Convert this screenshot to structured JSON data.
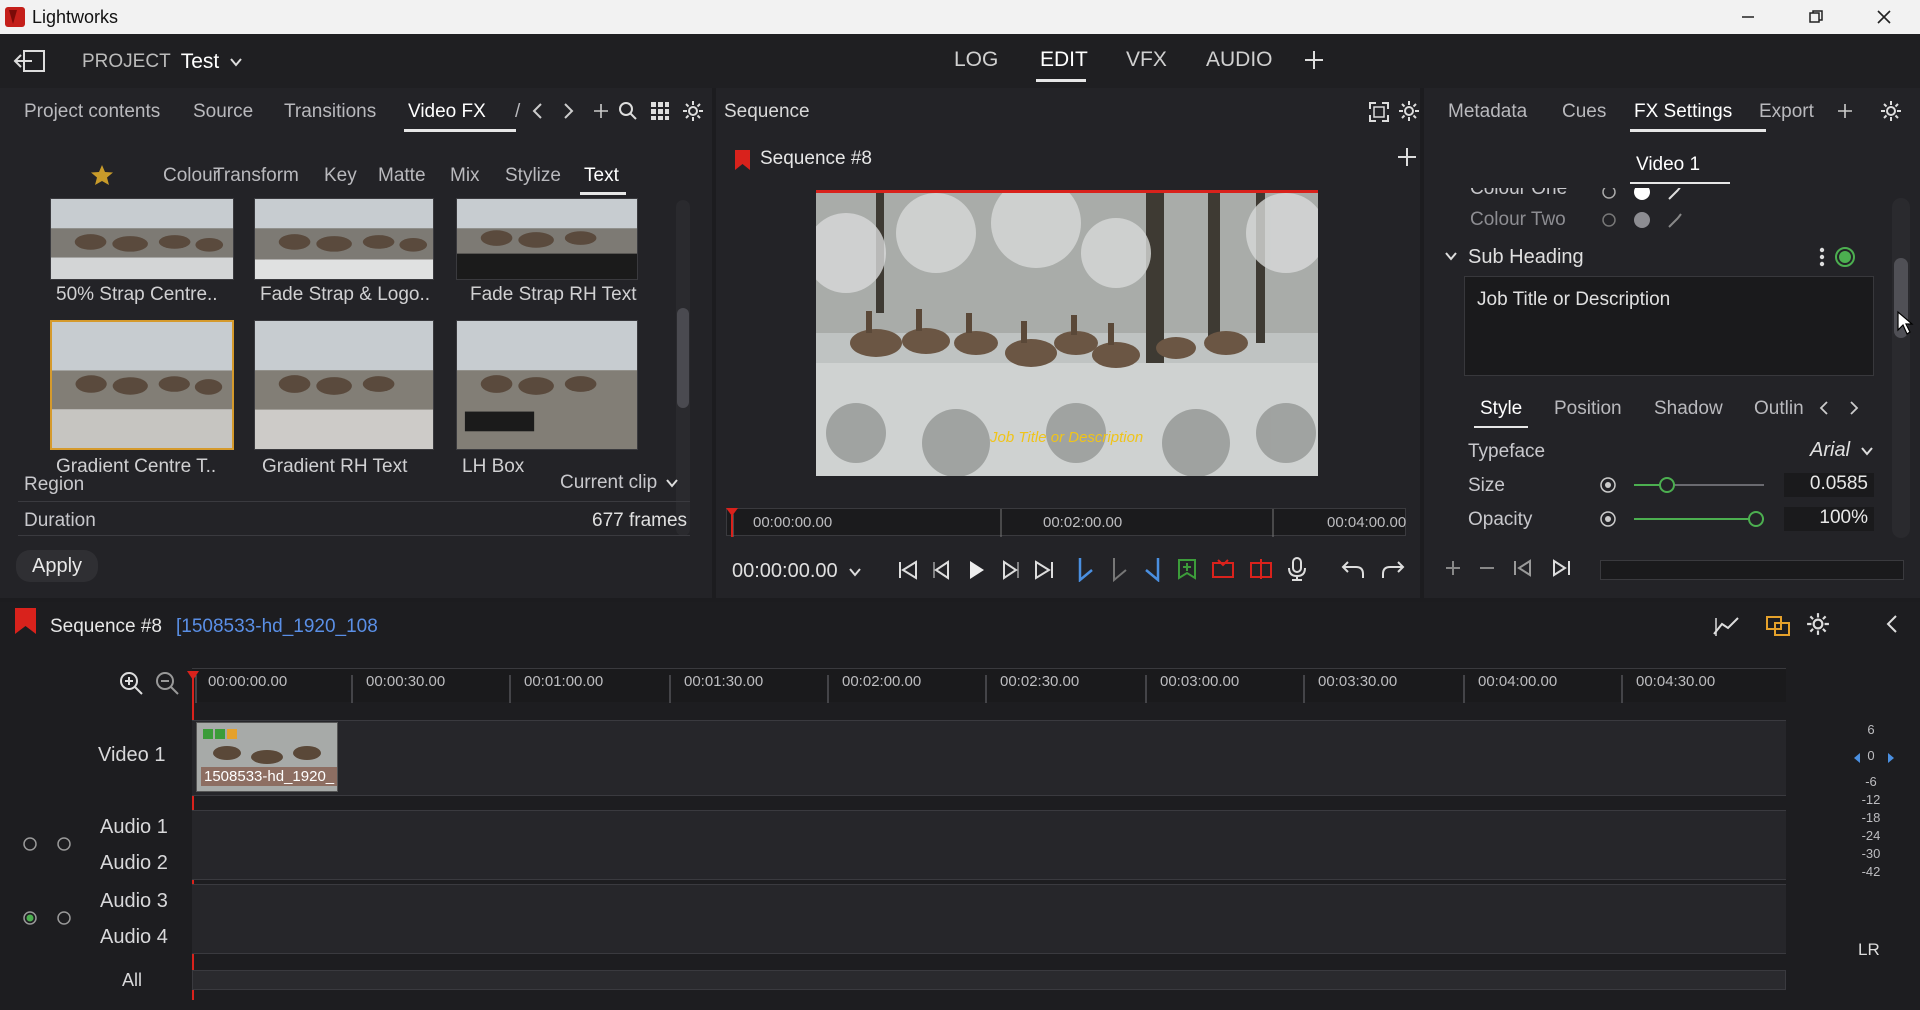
{
  "app": {
    "title": "Lightworks"
  },
  "header": {
    "project_prefix": "PROJECT",
    "project_name": "Test",
    "modes": [
      "LOG",
      "EDIT",
      "VFX",
      "AUDIO"
    ],
    "active_mode": "EDIT"
  },
  "left_panel": {
    "tabs": [
      "Project contents",
      "Source",
      "Transitions",
      "Video FX"
    ],
    "active_tab": "Video FX",
    "categories": [
      "Colour",
      "Transform",
      "Key",
      "Matte",
      "Mix",
      "Stylize",
      "Text"
    ],
    "active_category": "Text",
    "presets": [
      {
        "label": "50% Strap Centre..",
        "overlay": ""
      },
      {
        "label": "Fade Strap & Logo..",
        "overlay": ""
      },
      {
        "label": "Fade Strap RH Text",
        "overlay": ""
      },
      {
        "label": "Gradient Centre T..",
        "overlay": "",
        "selected": true
      },
      {
        "label": "Gradient RH Text",
        "overlay": ""
      },
      {
        "label": "LH Box",
        "overlay": ""
      }
    ],
    "region_label": "Region",
    "region_value": "Current clip",
    "duration_label": "Duration",
    "duration_value": "677 frames",
    "apply_label": "Apply"
  },
  "viewer": {
    "panel_title": "Sequence",
    "sequence_name": "Sequence #8",
    "overlay_text": "Job Title or Description",
    "ruler_labels": [
      "00:00:00.00",
      "00:02:00.00",
      "00:04:00.00"
    ],
    "timecode": "00:00:00.00"
  },
  "fx_panel": {
    "tabs": [
      "Metadata",
      "Cues",
      "FX Settings",
      "Export"
    ],
    "active_tab": "FX Settings",
    "subtab": "Video 1",
    "colour_one": "Colour One",
    "colour_two": "Colour Two",
    "section": "Sub Heading",
    "text_value": "Job Title or Description",
    "style_tabs": [
      "Style",
      "Position",
      "Shadow",
      "Outlin"
    ],
    "active_style_tab": "Style",
    "typeface_label": "Typeface",
    "typeface_value": "Arial",
    "size_label": "Size",
    "size_value": "0.0585",
    "opacity_label": "Opacity",
    "opacity_value": "100%"
  },
  "timeline": {
    "sequence_name": "Sequence #8",
    "clip_name": "[1508533-hd_1920_108",
    "ruler": [
      "00:00:00.00",
      "00:00:30.00",
      "00:01:00.00",
      "00:01:30.00",
      "00:02:00.00",
      "00:02:30.00",
      "00:03:00.00",
      "00:03:30.00",
      "00:04:00.00",
      "00:04:30.00"
    ],
    "video_track": "Video 1",
    "clip_label": "1508533-hd_1920_",
    "audio_tracks": [
      "Audio 1",
      "Audio 2",
      "Audio 3",
      "Audio 4"
    ],
    "all_label": "All",
    "meter_scale": [
      "6",
      "0",
      "-6",
      "-12",
      "-18",
      "-24",
      "-30",
      "-42"
    ],
    "meter_footer": "LR"
  },
  "colors": {
    "accent_red": "#d9221c",
    "selection_orange": "#d59a2c",
    "fx_green": "#4caf50",
    "clip_green": "#3c9c3a"
  }
}
